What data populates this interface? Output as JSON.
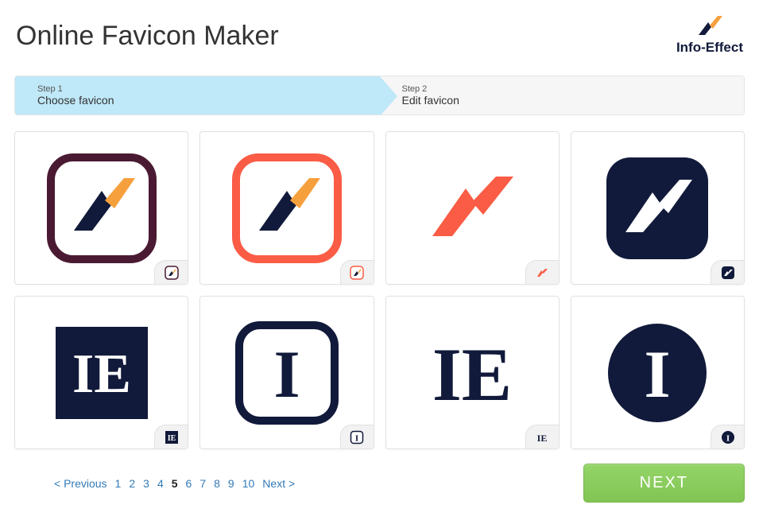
{
  "header": {
    "title": "Online Favicon Maker",
    "brand": "Info-Effect"
  },
  "steps": [
    {
      "small": "Step 1",
      "main": "Choose favicon",
      "active": true
    },
    {
      "small": "Step 2",
      "main": "Edit favicon",
      "active": false
    }
  ],
  "tiles": [
    {
      "name": "favicon-option-1"
    },
    {
      "name": "favicon-option-2"
    },
    {
      "name": "favicon-option-3"
    },
    {
      "name": "favicon-option-4"
    },
    {
      "name": "favicon-option-5"
    },
    {
      "name": "favicon-option-6"
    },
    {
      "name": "favicon-option-7"
    },
    {
      "name": "favicon-option-8"
    }
  ],
  "pagination": {
    "prev": "< Previous",
    "pages": [
      "1",
      "2",
      "3",
      "4",
      "5",
      "6",
      "7",
      "8",
      "9",
      "10"
    ],
    "current": "5",
    "nextPageLink": "Next >"
  },
  "nextButton": "NEXT",
  "colors": {
    "navy": "#111a3a",
    "orange": "#f6a03d",
    "coral": "#fa5c45",
    "maroon": "#4a1a33"
  }
}
